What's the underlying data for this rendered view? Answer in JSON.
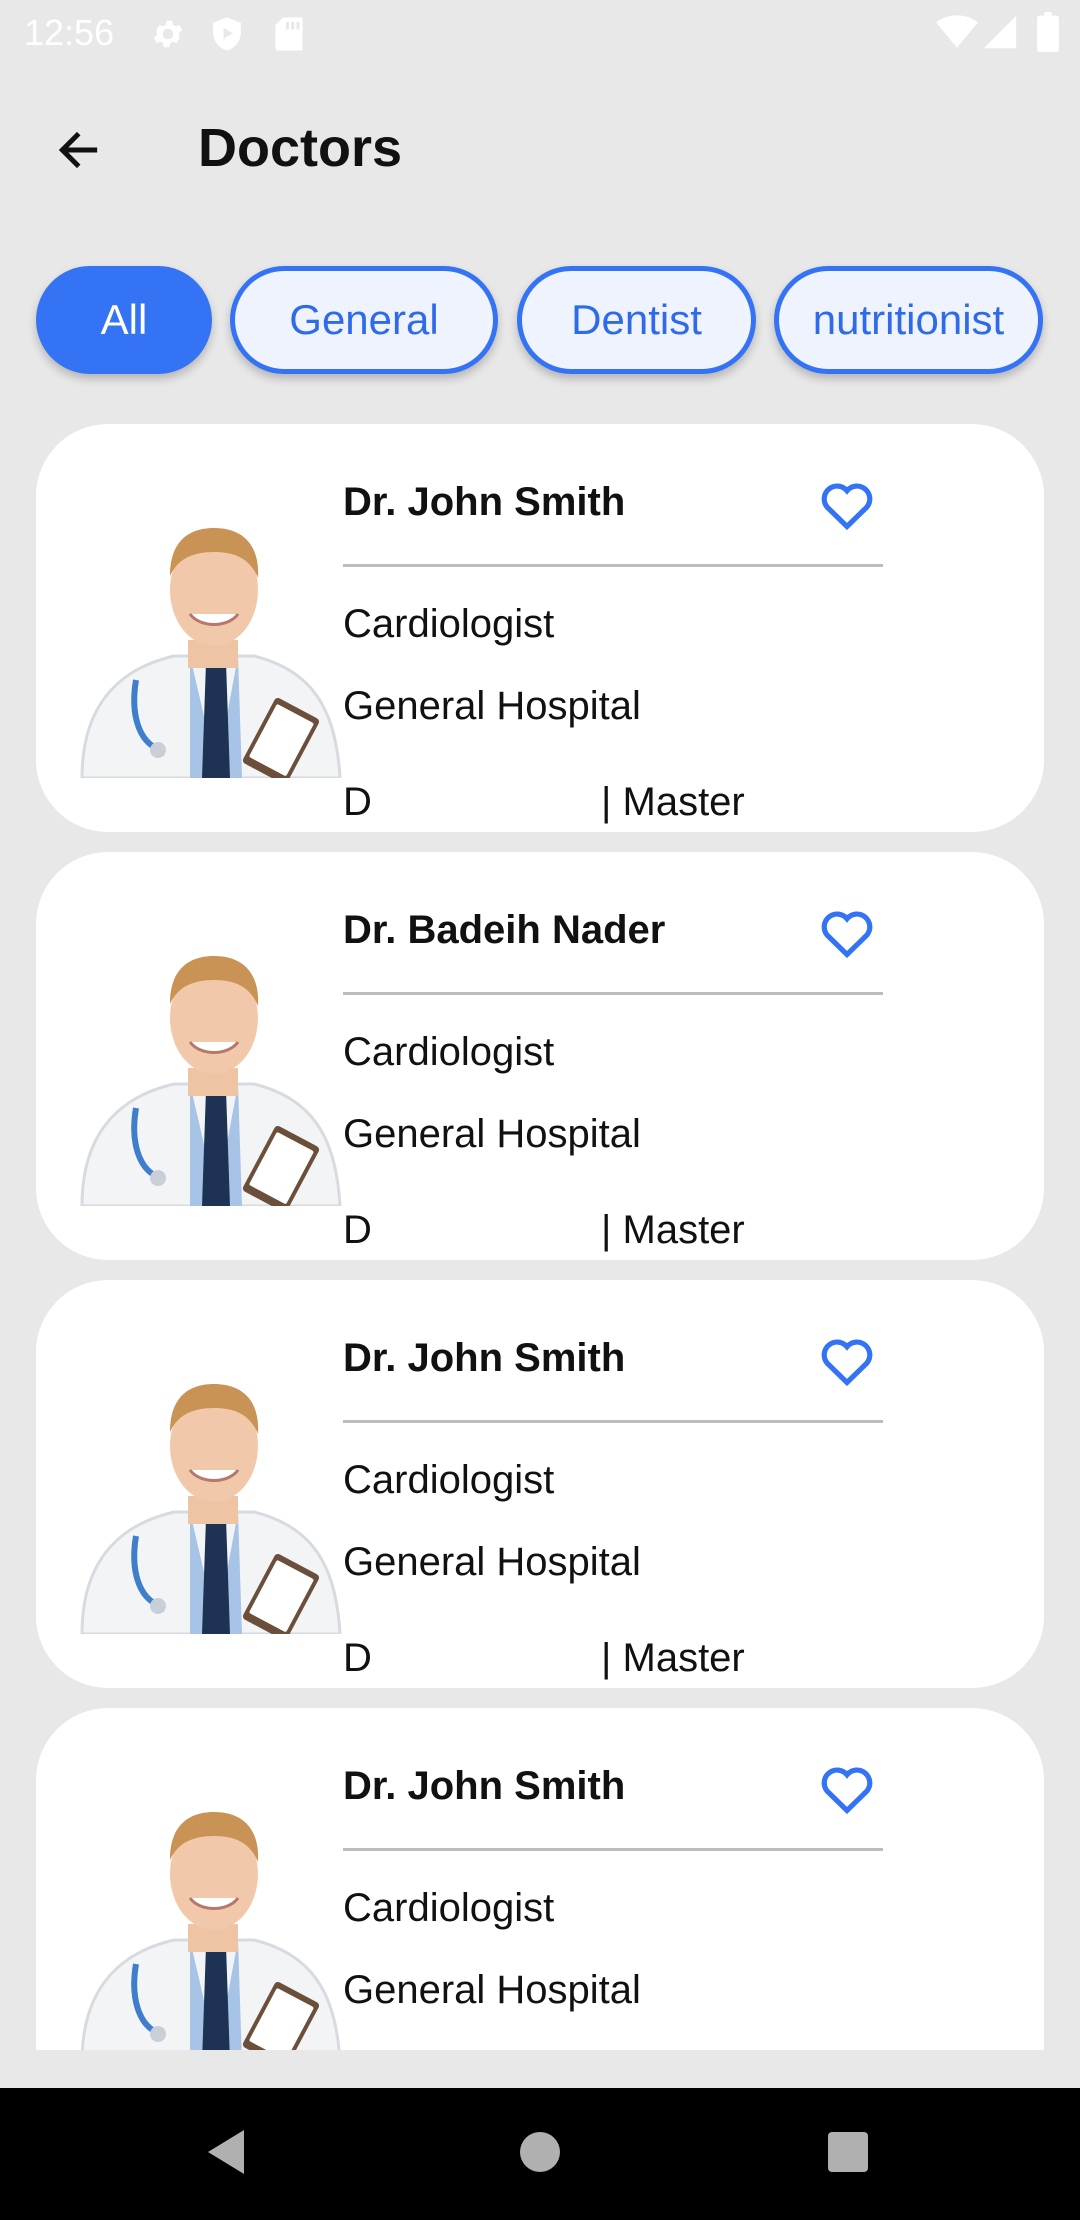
{
  "status_bar": {
    "time": "12:56",
    "icons_left": [
      "gear-icon",
      "shield-play-icon",
      "sd-card-icon"
    ],
    "icons_right": [
      "wifi-icon",
      "signal-icon",
      "battery-icon"
    ]
  },
  "header": {
    "back_icon": "arrow-left-icon",
    "title": "Doctors"
  },
  "filters": [
    {
      "label": "All",
      "active": true
    },
    {
      "label": "General",
      "active": false
    },
    {
      "label": "Dentist",
      "active": false
    },
    {
      "label": "nutritionist",
      "active": false
    }
  ],
  "doctors": [
    {
      "name": "Dr. John Smith",
      "specialty": "Cardiologist",
      "hospital": "General Hospital",
      "degree": "D",
      "rank": "| Master",
      "favorite_icon": "heart-outline-icon"
    },
    {
      "name": "Dr. Badeih Nader",
      "specialty": "Cardiologist",
      "hospital": "General Hospital",
      "degree": "D",
      "rank": "| Master",
      "favorite_icon": "heart-outline-icon"
    },
    {
      "name": "Dr. John Smith",
      "specialty": "Cardiologist",
      "hospital": "General Hospital",
      "degree": "D",
      "rank": "| Master",
      "favorite_icon": "heart-outline-icon"
    },
    {
      "name": "Dr. John Smith",
      "specialty": "Cardiologist",
      "hospital": "General Hospital",
      "favorite_icon": "heart-outline-icon"
    }
  ],
  "nav_bar": {
    "buttons": [
      "back-triangle-icon",
      "home-circle-icon",
      "recents-square-icon"
    ]
  },
  "colors": {
    "accent": "#3474f4",
    "background": "#e8e8e8",
    "card": "#ffffff"
  }
}
